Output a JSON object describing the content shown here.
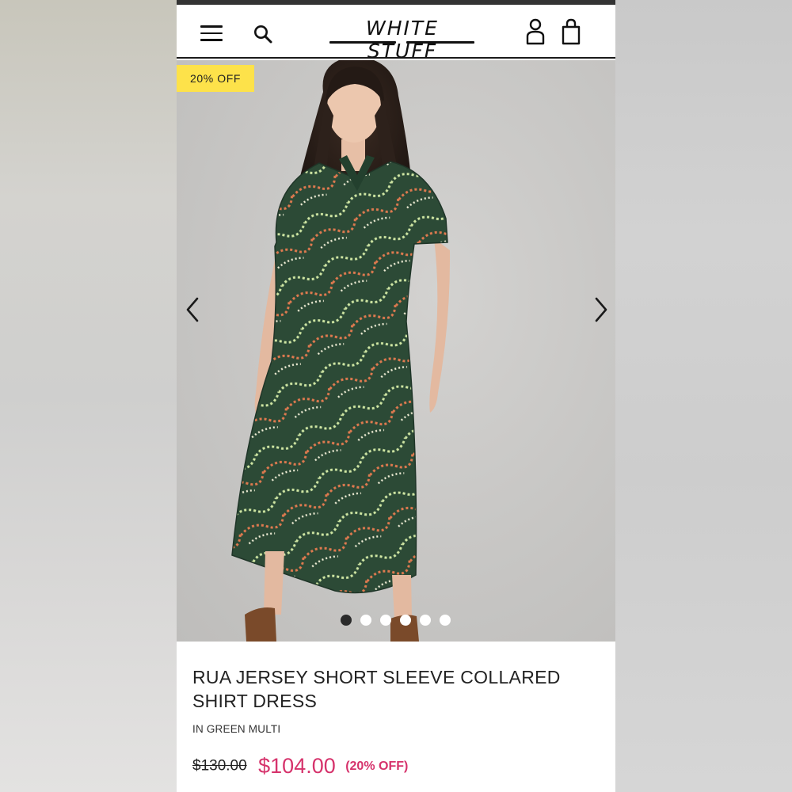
{
  "header": {
    "brand": "WHITE STUFF",
    "menu_icon": "hamburger-menu-icon",
    "search_icon": "search-icon",
    "account_icon": "account-icon",
    "bag_icon": "shopping-bag-icon"
  },
  "gallery": {
    "badge": "20% OFF",
    "prev_icon": "chevron-left-icon",
    "next_icon": "chevron-right-icon",
    "image_count": 6,
    "active_index": 0
  },
  "product": {
    "title": "RUA JERSEY SHORT SLEEVE COLLARED SHIRT DRESS",
    "color": "IN GREEN MULTI",
    "price_original": "$130.00",
    "price_sale": "$104.00",
    "discount": "(20% OFF)"
  },
  "colors": {
    "badge_yellow": "#fde24a",
    "sale_pink": "#d6336c",
    "dress_green": "#2c4a36"
  }
}
